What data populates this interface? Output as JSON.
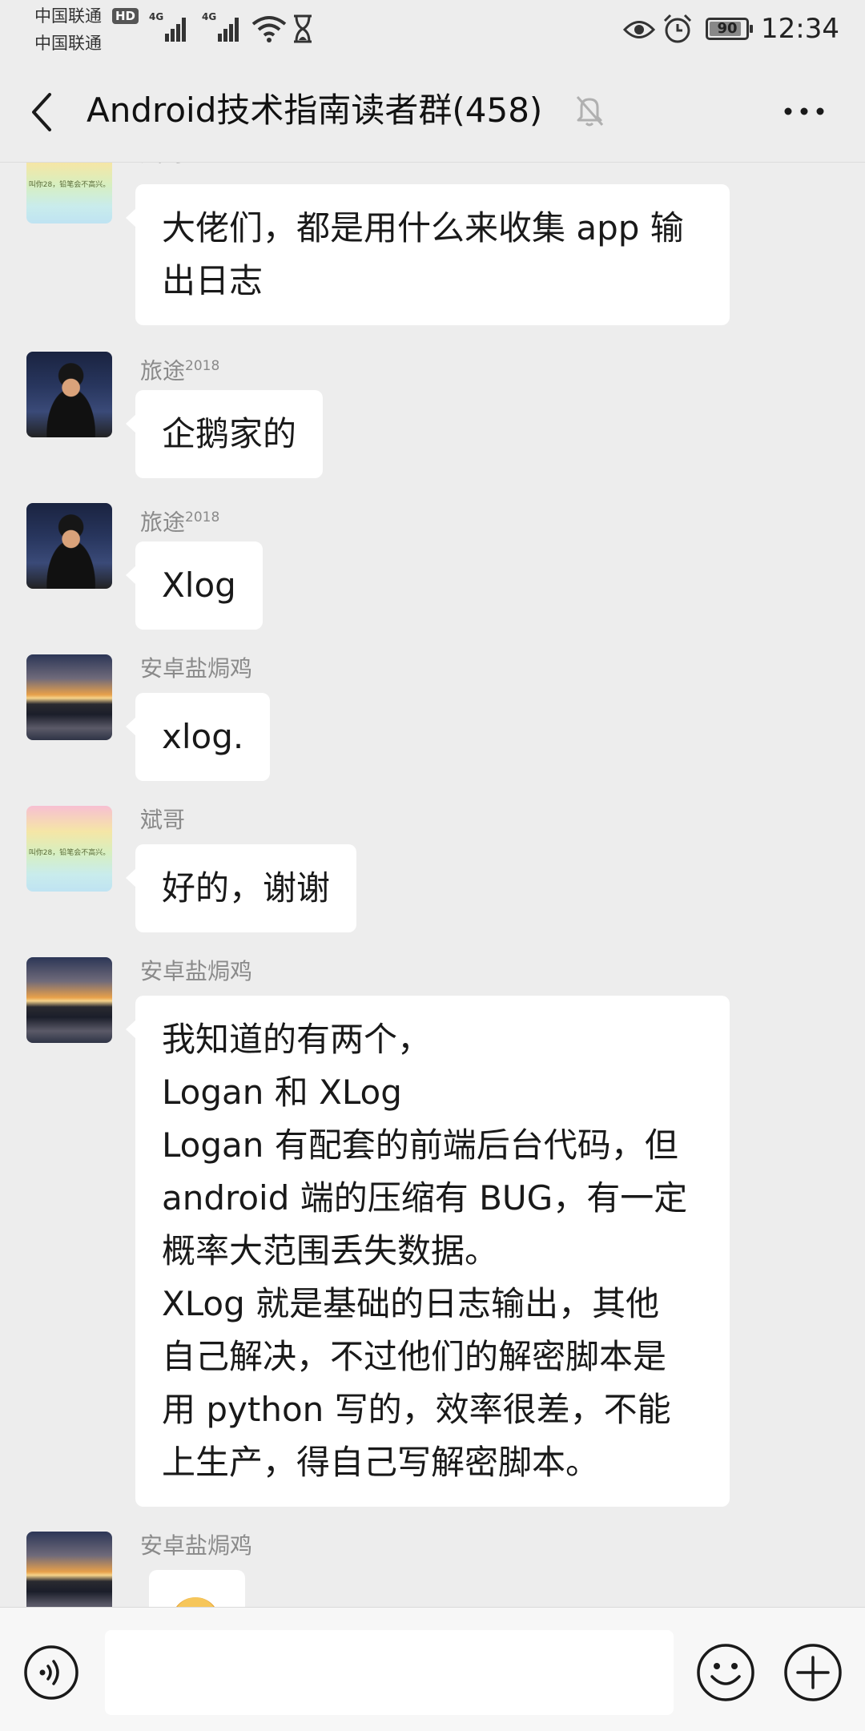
{
  "status_bar": {
    "carrier_1": "中国联通",
    "carrier_2": "中国联通",
    "hd_badge": "HD",
    "network_1": "4G",
    "network_2": "4G",
    "battery_level": 90,
    "battery_text": "90",
    "time": "12:34",
    "icons": [
      "signal-icon",
      "wifi-icon",
      "hourglass-icon",
      "eye-icon",
      "alarm-icon",
      "battery-icon"
    ]
  },
  "header": {
    "title": "Android技术指南读者群(458)",
    "icons": [
      "back-arrow-icon",
      "mute-bell-icon",
      "more-icon"
    ]
  },
  "messages": [
    {
      "sender": "斌哥",
      "avatar": "rainbow-avatar",
      "avatar_text": "叫你28，铅笔会不高兴。",
      "lines": [
        "大佬们，都是用什么来收集 app 输",
        "出日志"
      ]
    },
    {
      "sender": "旅途",
      "sender_sup": "2018",
      "avatar": "person-avatar",
      "lines": [
        "企鹅家的"
      ]
    },
    {
      "sender": "旅途",
      "sender_sup": "2018",
      "avatar": "person-avatar",
      "lines": [
        "Xlog"
      ]
    },
    {
      "sender": "安卓盐焗鸡",
      "avatar": "sunset-avatar",
      "lines": [
        "xlog."
      ]
    },
    {
      "sender": "斌哥",
      "avatar": "rainbow-avatar",
      "avatar_text": "叫你28，铅笔会不高兴。",
      "lines": [
        "好的，谢谢"
      ]
    },
    {
      "sender": "安卓盐焗鸡",
      "avatar": "sunset-avatar",
      "lines": [
        "我知道的有两个，",
        "Logan 和 XLog",
        "Logan 有配套的前端后台代码，但",
        "android 端的压缩有 BUG，有一定",
        "概率大范围丢失数据。",
        "XLog 就是基础的日志输出，其他",
        "自己解决，不过他们的解密脚本是",
        "用 python 写的，效率很差，不能",
        "上生产，得自己写解密脚本。"
      ]
    },
    {
      "sender": "安卓盐焗鸡",
      "avatar": "sunset-avatar",
      "sticker": "cat-sticker"
    }
  ],
  "input_bar": {
    "placeholder": "",
    "icons": [
      "voice-icon",
      "emoji-icon",
      "plus-icon"
    ]
  }
}
